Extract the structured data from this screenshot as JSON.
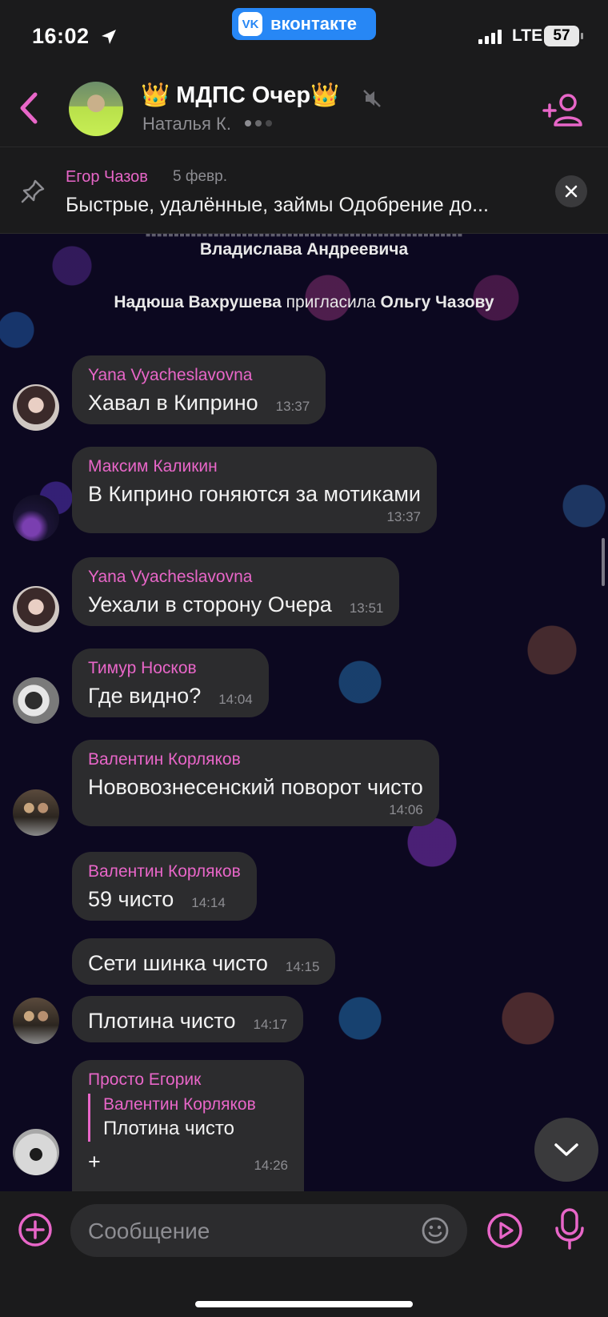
{
  "status_bar": {
    "time": "16:02",
    "app_pill_label": "вконтакте",
    "network": "LTE",
    "battery": "57"
  },
  "header": {
    "title": "👑 МДПС Очер👑",
    "subtitle": "Наталья К."
  },
  "pinned": {
    "author": "Егор Чазов",
    "date": "5 февр.",
    "text": "Быстрые, удалённые, займы Одобрение до..."
  },
  "chat": {
    "cut_off_text": "Владислава Андреевича",
    "system_message": {
      "actor": "Надюша Вахрушева",
      "action": "пригласила",
      "target": "Ольгу Чазову"
    },
    "messages": [
      {
        "author": "Yana Vyacheslavovna",
        "text": "Хавал в Киприно",
        "time": "13:37"
      },
      {
        "author": "Максим Каликин",
        "text": "В Киприно гоняются за мотиками",
        "time": "13:37"
      },
      {
        "author": "Yana Vyacheslavovna",
        "text": "Уехали в сторону Очера",
        "time": "13:51"
      },
      {
        "author": "Тимур Носков",
        "text": "Где видно?",
        "time": "14:04"
      },
      {
        "author": "Валентин Корляков",
        "text": "Нововознесенский поворот чисто",
        "time": "14:06"
      },
      {
        "author": "Валентин Корляков",
        "text": "59 чисто",
        "time": "14:14"
      },
      {
        "author": "",
        "text": "Сети шинка чисто",
        "time": "14:15"
      },
      {
        "author": "",
        "text": "Плотина чисто",
        "time": "14:17"
      },
      {
        "author": "Просто Егорик",
        "reply_author": "Валентин Корляков",
        "reply_text": "Плотина чисто",
        "text": "+",
        "time": "14:26"
      }
    ]
  },
  "composer": {
    "placeholder": "Сообщение"
  },
  "colors": {
    "accent": "#e866c8",
    "bubble": "#2c2c2e",
    "bar": "#1b1b1c",
    "vk_blue": "#2787f5"
  },
  "icons": [
    "location-arrow-icon",
    "vk-logo-icon",
    "back-chevron-icon",
    "mute-icon",
    "add-user-icon",
    "pin-icon",
    "close-icon",
    "chevron-down-icon",
    "plus-circle-icon",
    "emoji-icon",
    "video-message-icon",
    "microphone-icon"
  ]
}
